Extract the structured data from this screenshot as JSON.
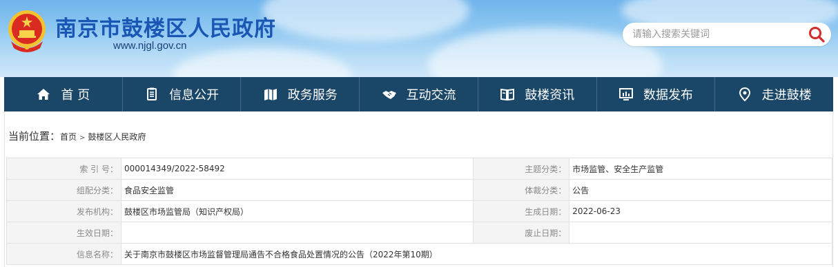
{
  "header": {
    "title": "南京市鼓楼区人民政府",
    "url": "www.njgl.gov.cn",
    "emblem_icon": "national-emblem-icon",
    "search": {
      "placeholder": "请输入搜索关键词",
      "icon": "search-icon"
    }
  },
  "nav": {
    "items": [
      {
        "label": "首 页",
        "icon": "home-icon"
      },
      {
        "label": "信息公开",
        "icon": "document-icon"
      },
      {
        "label": "政务服务",
        "icon": "map-icon"
      },
      {
        "label": "互动交流",
        "icon": "handshake-icon"
      },
      {
        "label": "鼓楼资讯",
        "icon": "book-icon"
      },
      {
        "label": "数据发布",
        "icon": "chart-monitor-icon"
      },
      {
        "label": "走进鼓楼",
        "icon": "location-pin-icon"
      }
    ]
  },
  "breadcrumb": {
    "lead": "当前位置：",
    "items": [
      "首页",
      "鼓楼区人民政府"
    ],
    "separator": ">"
  },
  "meta": {
    "index_label": "索 引 号：",
    "index_value": "000014349/2022-58492",
    "topic_label": "主题分类：",
    "topic_value": "市场监管、安全生产监管",
    "org_class_label": "组配分类：",
    "org_class_value": "食品安全监管",
    "genre_label": "体裁分类：",
    "genre_value": "公告",
    "issuer_label": "发布机构：",
    "issuer_value": "鼓楼区市场监管局（知识产权局）",
    "created_label": "生成日期：",
    "created_value": "2022-06-23",
    "effective_label": "生效日期：",
    "effective_value": "",
    "expire_label": "废止日期：",
    "expire_value": "",
    "name_label": "信息名称：",
    "name_value": "关于南京市鼓楼区市场监督管理局通告不合格食品处置情况的公告（2022年第10期）"
  },
  "colors": {
    "nav_bg": "#1a4667",
    "title": "#1a57b5",
    "search_icon": "#d42a2a"
  }
}
